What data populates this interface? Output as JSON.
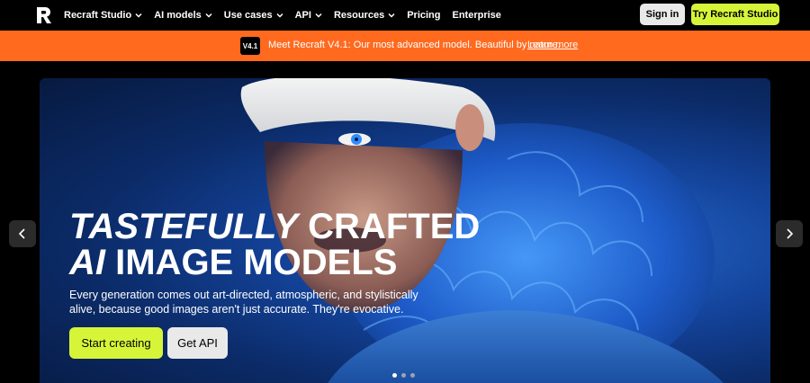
{
  "nav": {
    "logo_alt": "Recraft",
    "items": [
      {
        "label": "Recraft Studio",
        "dropdown": true
      },
      {
        "label": "AI models",
        "dropdown": true
      },
      {
        "label": "Use cases",
        "dropdown": true
      },
      {
        "label": "API",
        "dropdown": true
      },
      {
        "label": "Resources",
        "dropdown": true
      },
      {
        "label": "Pricing",
        "dropdown": false
      },
      {
        "label": "Enterprise",
        "dropdown": false
      }
    ],
    "signin_label": "Sign in",
    "try_label": "Try Recraft Studio"
  },
  "banner": {
    "badge": "V4.1",
    "text": "Meet Recraft V4.1: Our most advanced model. Beautiful by nature.",
    "link": "Learn more"
  },
  "hero": {
    "headline_line1_italic": "TASTEFULLY",
    "headline_line1_rest": "CRAFTED",
    "headline_line2_italic": "AI",
    "headline_line2_rest": "IMAGE MODELS",
    "subtitle": "Every generation comes out art-directed, atmospheric, and stylistically alive, because good images aren't just accurate. They're evocative.",
    "primary_cta": "Start creating",
    "secondary_cta": "Get API"
  },
  "carousel": {
    "slide_count": 3,
    "active_index": 0
  },
  "colors": {
    "accent": "#d7f538",
    "banner": "#ff6a1f",
    "background": "#000000"
  }
}
